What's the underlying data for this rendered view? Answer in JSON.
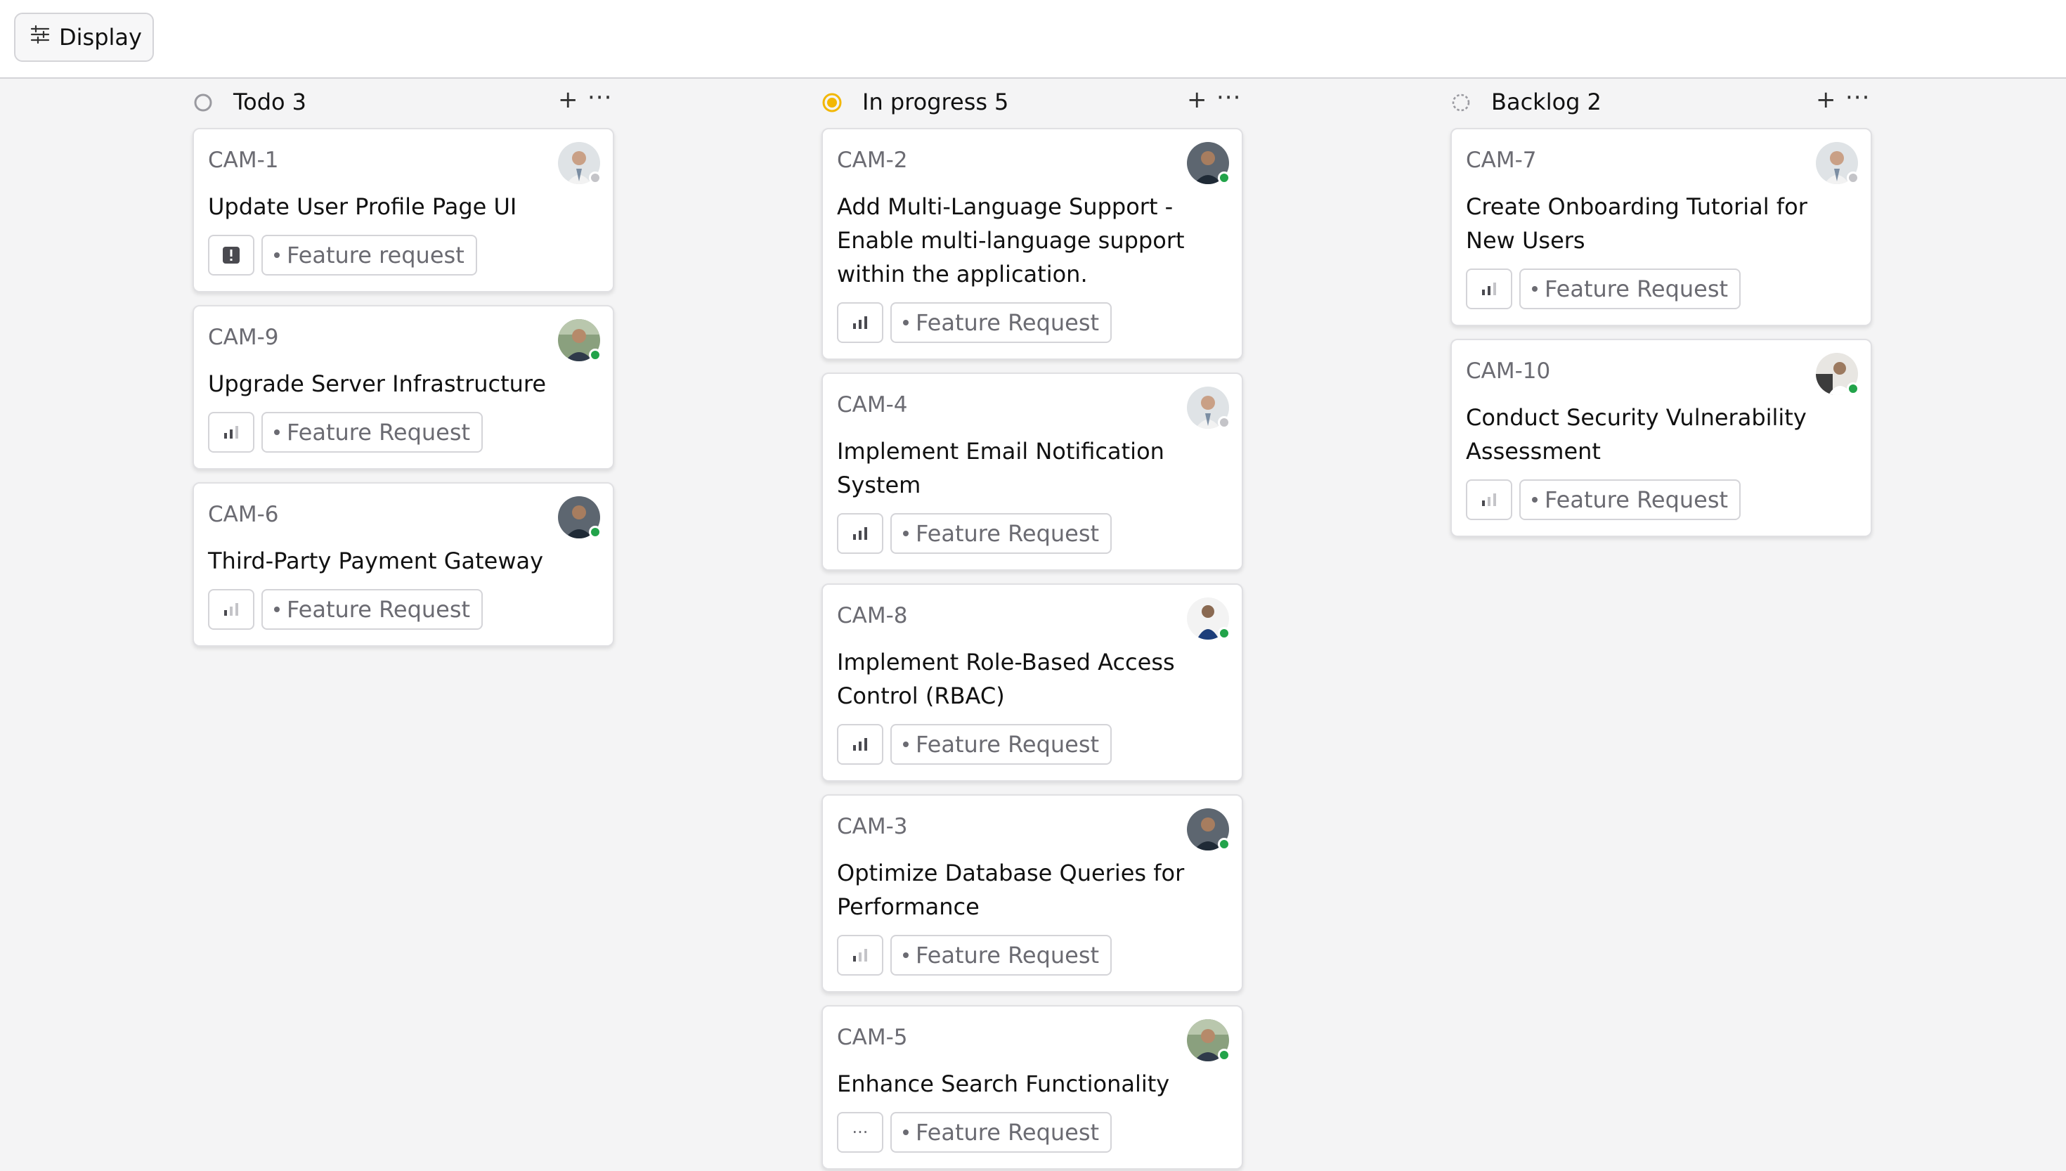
{
  "toolbar": {
    "display_label": "Display"
  },
  "colors": {
    "presence_online": "#22a34a",
    "presence_offline": "#c4c4c8",
    "in_progress": "#f2b705",
    "todo": "#9a9aa0"
  },
  "columns": [
    {
      "title": "Todo",
      "count": "3",
      "status_icon": "circle-empty-icon",
      "cards": [
        {
          "id": "CAM-1",
          "title": "Update User Profile Page UI",
          "priority": "urgent-icon",
          "label": "Feature request",
          "presence": "offline"
        },
        {
          "id": "CAM-9",
          "title": "Upgrade Server Infrastructure",
          "priority": "medium-priority-icon",
          "label": "Feature Request",
          "presence": "online"
        },
        {
          "id": "CAM-6",
          "title": "Third-Party Payment Gateway",
          "priority": "low-priority-icon",
          "label": "Feature Request",
          "presence": "online"
        }
      ]
    },
    {
      "title": "In progress",
      "count": "5",
      "status_icon": "in-progress-icon",
      "cards": [
        {
          "id": "CAM-2",
          "title": "Add Multi-Language Support - Enable multi-language support within the application.",
          "priority": "high-priority-icon",
          "label": "Feature Request",
          "presence": "online"
        },
        {
          "id": "CAM-4",
          "title": "Implement Email Notification System",
          "priority": "high-priority-icon",
          "label": "Feature Request",
          "presence": "offline"
        },
        {
          "id": "CAM-8",
          "title": "Implement Role-Based Access Control (RBAC)",
          "priority": "high-priority-icon",
          "label": "Feature Request",
          "presence": "online"
        },
        {
          "id": "CAM-3",
          "title": "Optimize Database Queries for Performance",
          "priority": "low-priority-icon",
          "label": "Feature Request",
          "presence": "online"
        },
        {
          "id": "CAM-5",
          "title": "Enhance Search Functionality",
          "priority": "no-priority-icon",
          "label": "Feature Request",
          "presence": "online"
        }
      ]
    },
    {
      "title": "Backlog",
      "count": "2",
      "status_icon": "circle-dashed-icon",
      "cards": [
        {
          "id": "CAM-7",
          "title": "Create Onboarding Tutorial for New Users",
          "priority": "medium-priority-icon",
          "label": "Feature Request",
          "presence": "offline"
        },
        {
          "id": "CAM-10",
          "title": "Conduct Security Vulnerability Assessment",
          "priority": "low-priority-icon",
          "label": "Feature Request",
          "presence": "online"
        }
      ]
    }
  ]
}
